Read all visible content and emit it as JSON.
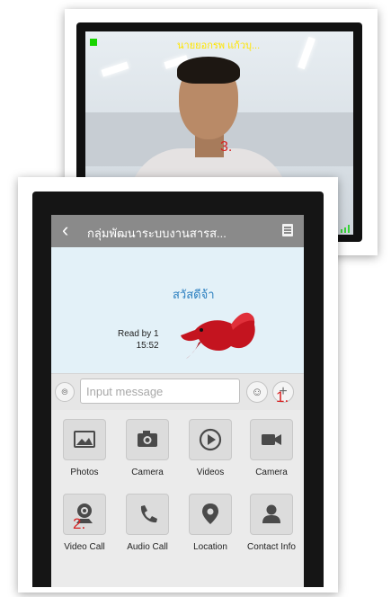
{
  "video_call": {
    "caller_name": "นายยอกรพ แก้วบุ...",
    "marker": "3.",
    "icons": {
      "status": "green-status-dot",
      "signal": "signal-bars-icon"
    }
  },
  "chat_screen": {
    "title": "กลุ่มพัฒนาระบบงานสารส...",
    "icons": {
      "back": "chevron-left-icon",
      "menu": "menu-icon"
    },
    "sticker_text": "สวัสดีจ้า",
    "read_status": {
      "read_by": "Read by 1",
      "time": "15:52"
    },
    "input": {
      "placeholder": "Input message"
    },
    "markers": {
      "plus": "1.",
      "video_call": "2."
    },
    "attachments": [
      {
        "label": "Photos",
        "icon": "image-icon"
      },
      {
        "label": "Camera",
        "icon": "camera-icon"
      },
      {
        "label": "Videos",
        "icon": "play-icon"
      },
      {
        "label": "Camera",
        "icon": "video-camera-icon"
      },
      {
        "label": "Video Call",
        "icon": "video-call-icon"
      },
      {
        "label": "Audio Call",
        "icon": "phone-icon"
      },
      {
        "label": "Location",
        "icon": "location-pin-icon"
      },
      {
        "label": "Contact Info",
        "icon": "contact-icon"
      }
    ]
  },
  "colors": {
    "nav_bar": "#8a8a8a",
    "chat_bg": "#e3f1f8",
    "marker": "#d62222",
    "caller_text": "#ffe500",
    "status_green": "#19d400"
  }
}
